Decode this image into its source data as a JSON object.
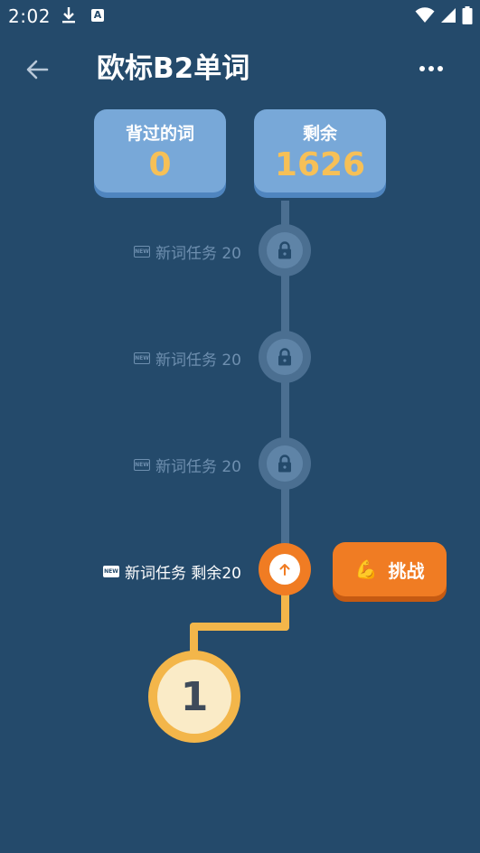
{
  "status_bar": {
    "time": "2:02",
    "icons": [
      "download-icon",
      "a-badge-icon",
      "wifi-icon",
      "signal-icon",
      "battery-icon"
    ]
  },
  "header": {
    "title": "欧标B2单词"
  },
  "stats": {
    "learned_label": "背过的词",
    "learned_value": "0",
    "remaining_label": "剩余",
    "remaining_value": "1626"
  },
  "tasks": [
    {
      "label": "新词任务 20",
      "state": "locked"
    },
    {
      "label": "新词任务 20",
      "state": "locked"
    },
    {
      "label": "新词任务 20",
      "state": "locked"
    },
    {
      "label": "新词任务 剩余20",
      "state": "current"
    }
  ],
  "badge_text": "NEW",
  "challenge": {
    "emoji": "💪",
    "label": "挑战"
  },
  "level": {
    "number": "1"
  },
  "colors": {
    "background": "#244a6b",
    "card": "#78a8d8",
    "accent_orange": "#f07c23",
    "accent_yellow": "#f3b64a",
    "stat_value": "#f6c057"
  }
}
